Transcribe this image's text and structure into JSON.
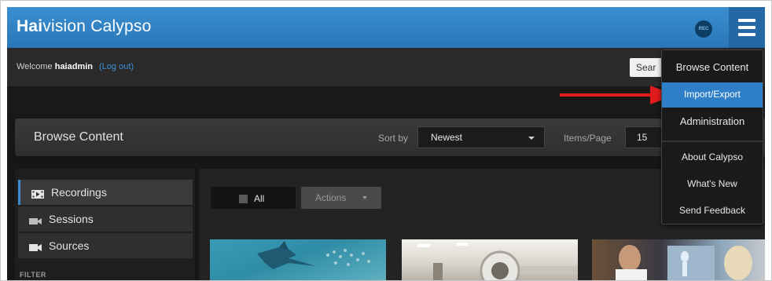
{
  "app": {
    "brand_bold": "Hai",
    "brand_rest": "vision Calypso",
    "rec_badge": "REC"
  },
  "welcome": {
    "prefix": "Welcome",
    "user": "haiadmin",
    "logout": "(Log out)"
  },
  "search": {
    "placeholder": "Sear"
  },
  "browse": {
    "title": "Browse Content",
    "sort_label": "Sort by",
    "sort_value": "Newest",
    "items_label": "Items/Page",
    "items_value": "15"
  },
  "sidebar": {
    "items": [
      {
        "label": "Recordings",
        "icon": "film-icon",
        "active": true
      },
      {
        "label": "Sessions",
        "icon": "camera-icon",
        "active": false
      },
      {
        "label": "Sources",
        "icon": "video-camera-icon",
        "active": false
      }
    ],
    "filter_label": "FILTER"
  },
  "toolbar": {
    "all_label": "All",
    "actions_label": "Actions"
  },
  "menu": {
    "items": [
      {
        "label": "Browse Content"
      },
      {
        "label": "Import/Export",
        "active": true
      },
      {
        "label": "Administration"
      },
      {
        "label": "About Calypso"
      },
      {
        "label": "What's New"
      },
      {
        "label": "Send Feedback"
      }
    ]
  },
  "colors": {
    "brand_blue": "#2e7fc7",
    "arrow_red": "#e11b1b"
  }
}
